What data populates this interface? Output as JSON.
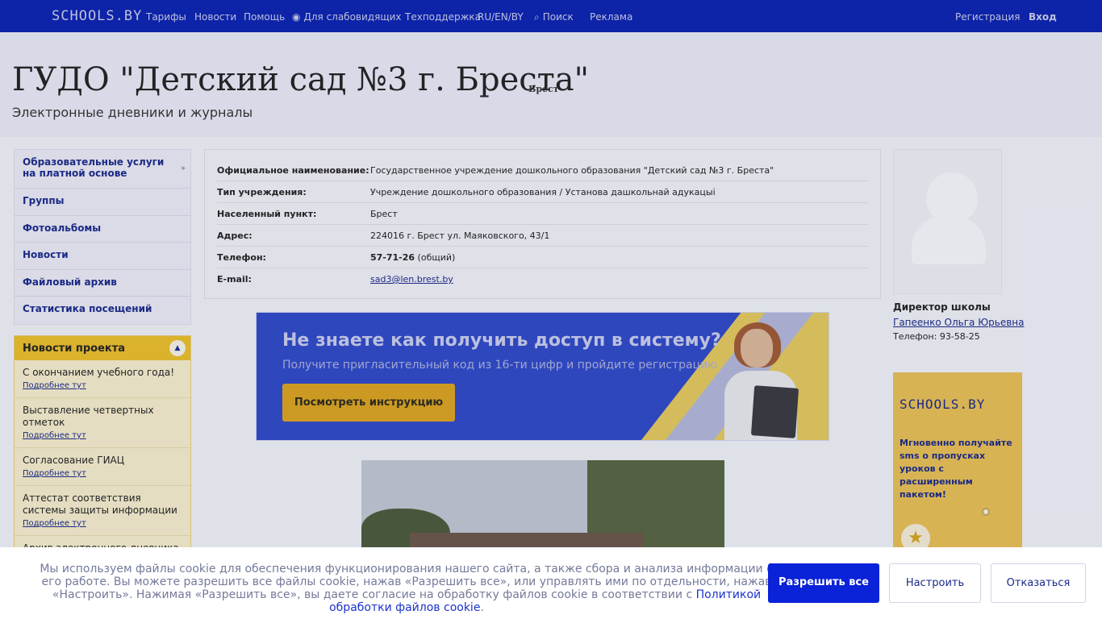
{
  "topbar": {
    "logo": "SCHOOLS.BY",
    "nav": [
      "Тарифы",
      "Новости",
      "Помощь",
      "Для слабовидящих",
      "Техподдержка",
      "RU/EN/BY",
      "Поиск",
      "Реклама"
    ],
    "register": "Регистрация",
    "login": "Вход"
  },
  "header": {
    "title": "ГУДО \"Детский сад №3 г. Бреста\"",
    "city": "Брест",
    "subtitle": "Электронные дневники и журналы"
  },
  "sidebar": {
    "items": [
      "Образовательные услуги на платной основе",
      "Группы",
      "Фотоальбомы",
      "Новости",
      "Файловый архив",
      "Статистика посещений"
    ]
  },
  "project_news": {
    "title": "Новости проекта",
    "more_label": "Подробнее тут",
    "items": [
      "С окончанием учебного года!",
      "Выставление четвертных отметок",
      "Согласование ГИАЦ",
      "Аттестат соответствия системы защиты информации",
      "Архив электронного дневника"
    ]
  },
  "info": {
    "rows": [
      {
        "key": "Официальное наименование:",
        "value": "Государственное учреждение дошкольного образования \"Детский сад №3 г. Бреста\""
      },
      {
        "key": "Тип учреждения:",
        "value": "Учреждение дошкольного образования / Установа дашкольнай адукацыі"
      },
      {
        "key": "Населенный пункт:",
        "value": "Брест"
      },
      {
        "key": "Адрес:",
        "value": "224016 г. Брест ул. Маяковского, 43/1"
      },
      {
        "key": "Телефон:",
        "value": "57-71-26",
        "suffix": " (общий)"
      },
      {
        "key": "E-mail:",
        "value": "sad3@len.brest.by"
      }
    ]
  },
  "banner": {
    "heading": "Не знаете как получить доступ в систему?",
    "sub": "Получите пригласительный код из 16-ти цифр и пройдите регистрацию",
    "button": "Посмотреть инструкцию"
  },
  "director": {
    "role": "Директор школы",
    "name": "Гапеенко Ольга Юрьевна",
    "phone": "Телефон: 93-58-25"
  },
  "promo": {
    "logo": "SCHOOLS.BY",
    "text": "Мгновенно получайте sms о пропусках уроков с расширенным пакетом!"
  },
  "cookie": {
    "text": "Мы используем файлы cookie для обеспечения функционирования нашего сайта, а также сбора и анализа информации о его работе. Вы можете разрешить все файлы cookie, нажав «Разрешить все», или управлять ими по отдельности, нажав «Настроить». Нажимая «Разрешить все», вы даете согласие на обработку файлов cookie в соответствии с ",
    "link": "Политикой обработки файлов cookie",
    "tail": ".",
    "allow": "Разрешить все",
    "settings": "Настроить",
    "decline": "Отказаться"
  }
}
